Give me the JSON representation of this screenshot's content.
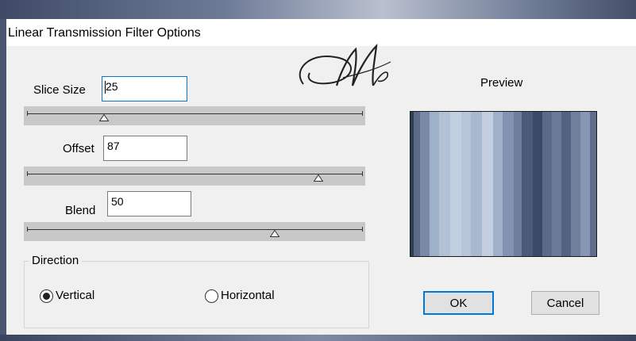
{
  "window": {
    "title": "Linear Transmission Filter Options"
  },
  "logo": {
    "icon": "script-monogram-logo",
    "text": "M",
    "color": "#222222"
  },
  "controls": {
    "slice_size": {
      "label": "Slice Size",
      "value": "25",
      "slider_fraction": 0.23
    },
    "offset": {
      "label": "Offset",
      "value": "87",
      "slider_fraction": 0.87
    },
    "blend": {
      "label": "Blend",
      "value": "50",
      "slider_fraction": 0.74
    }
  },
  "direction": {
    "legend": "Direction",
    "options": [
      {
        "label": "Vertical",
        "selected": true
      },
      {
        "label": "Horizontal",
        "selected": false
      }
    ]
  },
  "preview": {
    "label": "Preview",
    "stripe_colors": [
      "#2f3d56",
      "#9fb0c9",
      "#c2cfe1",
      "#3a4965",
      "#8797b3"
    ]
  },
  "buttons": {
    "ok_label": "OK",
    "cancel_label": "Cancel"
  },
  "colors": {
    "focus_accent": "#0078d7",
    "slider_background": "#c8c8c8",
    "dialog_background": "#f0f0f0"
  }
}
